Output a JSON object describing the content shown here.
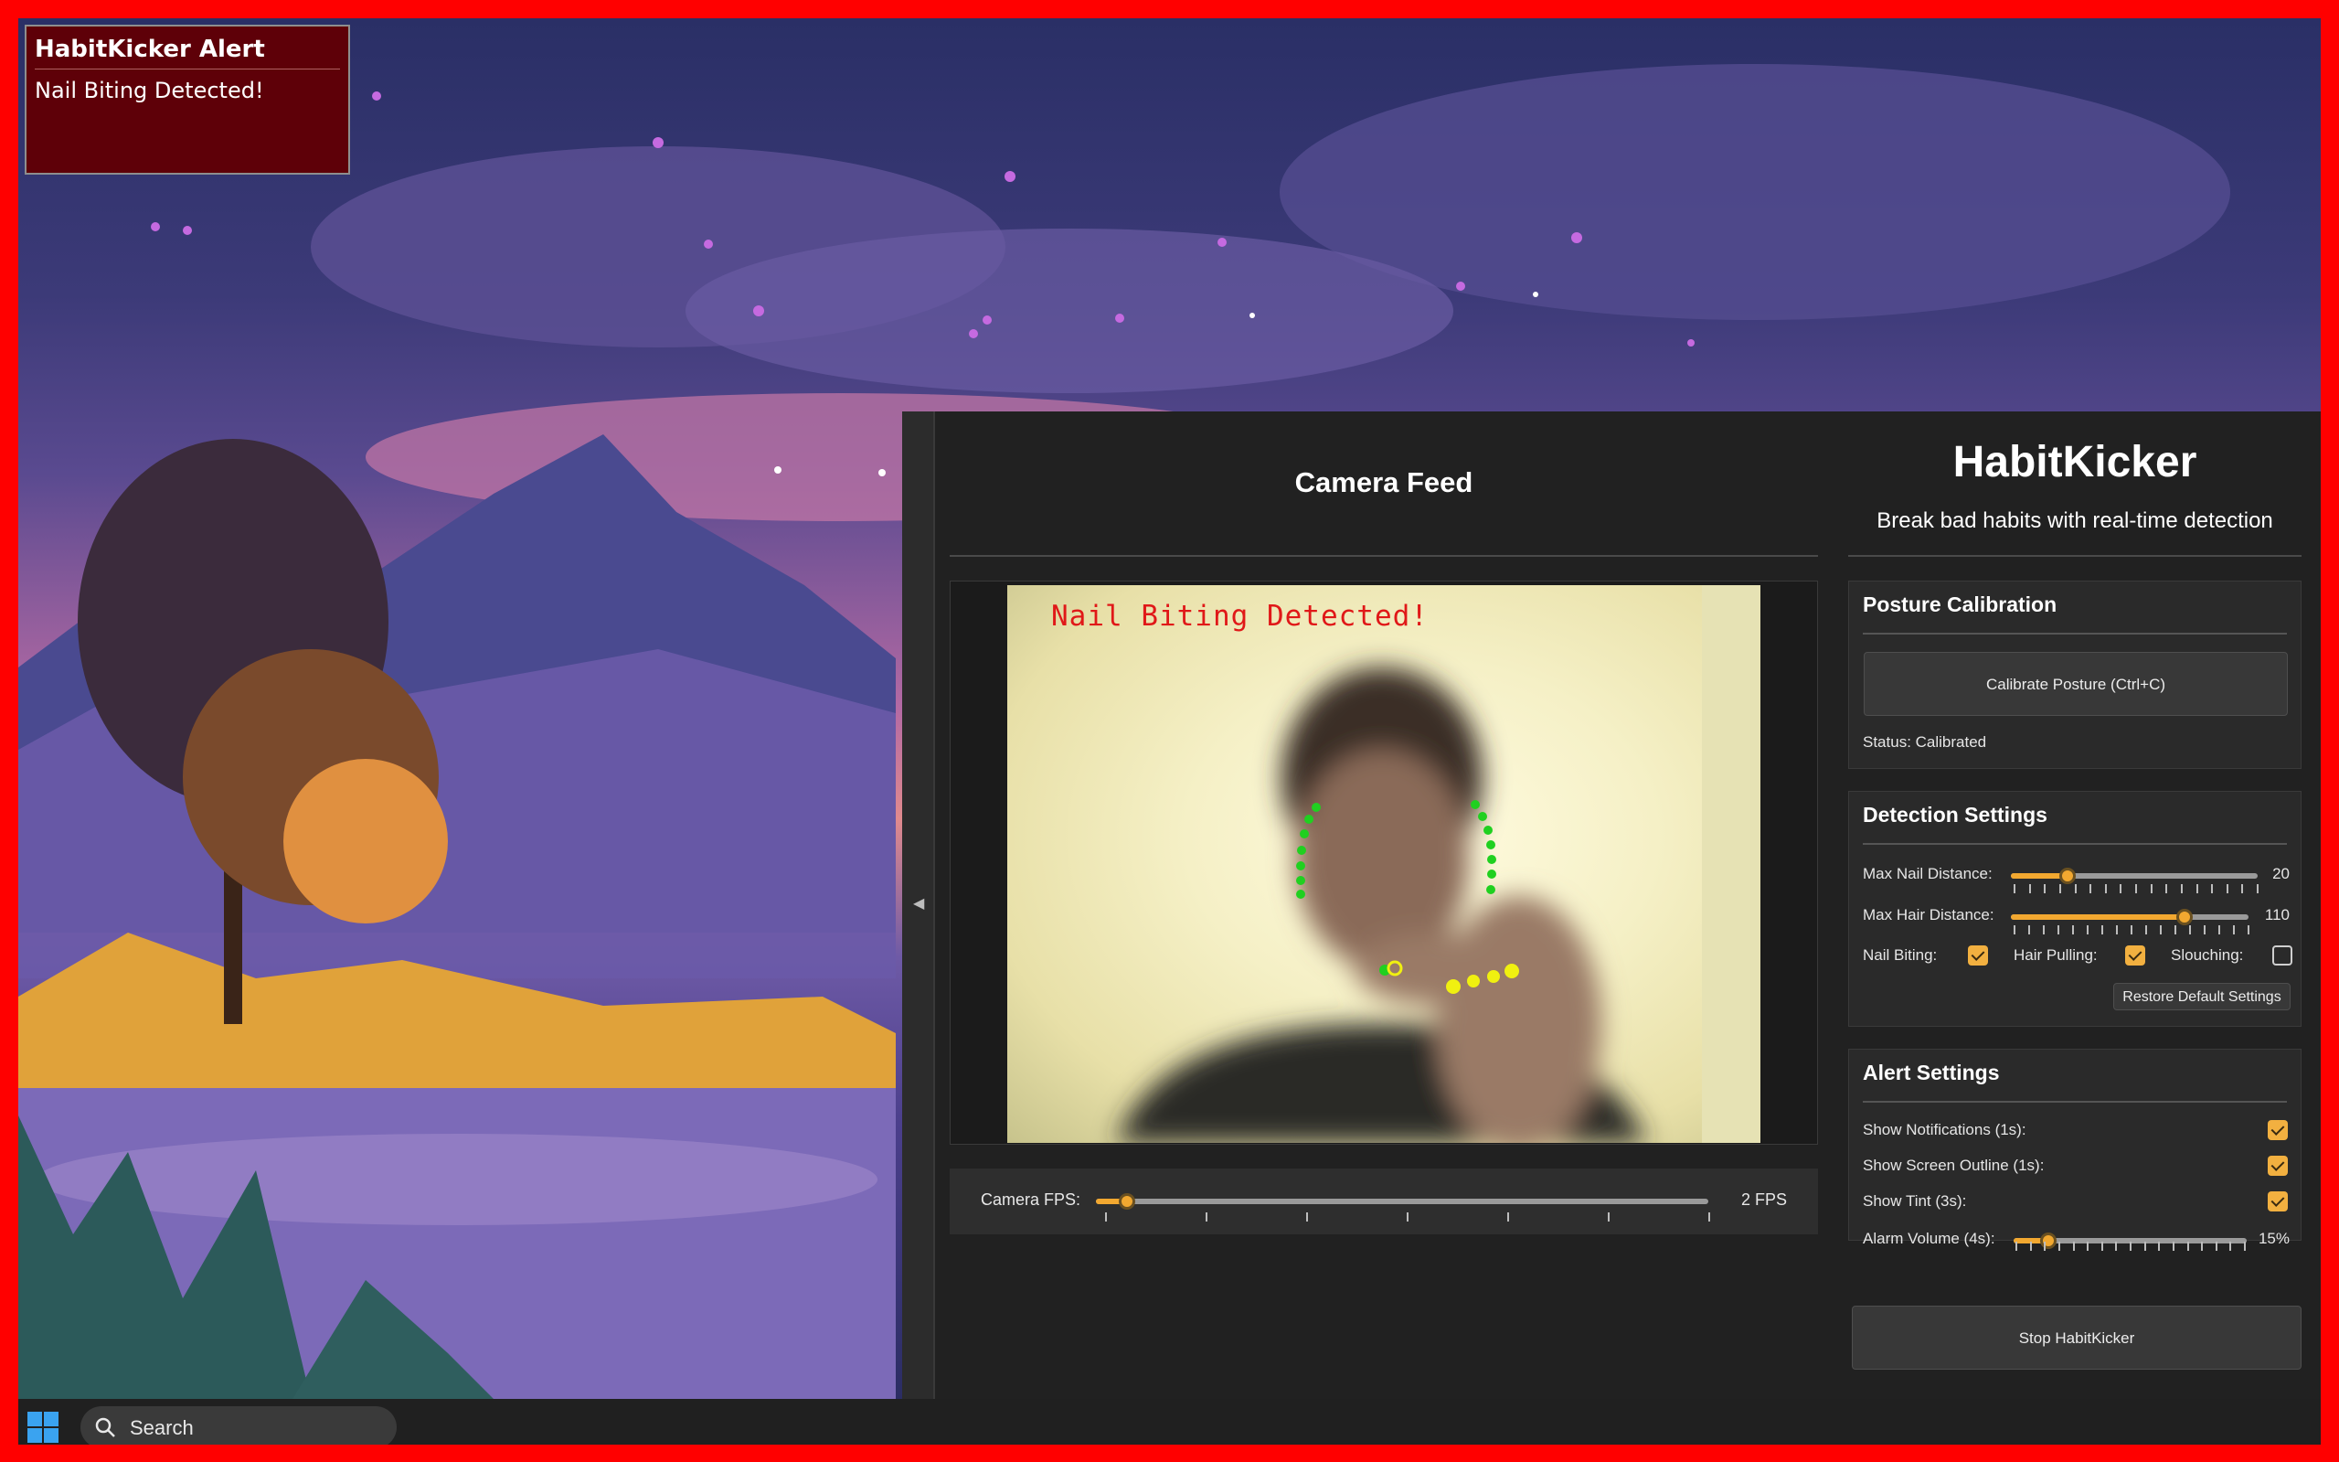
{
  "alert": {
    "title": "HabitKicker Alert",
    "message": "Nail Biting Detected!"
  },
  "taskbar": {
    "search_label": "Search"
  },
  "camera": {
    "title": "Camera Feed",
    "overlay_text": "Nail Biting Detected!",
    "fps_label": "Camera FPS:",
    "fps_value": "2 FPS",
    "fps_fraction": 0.05
  },
  "app": {
    "title": "HabitKicker",
    "subtitle": "Break bad habits with real-time detection"
  },
  "posture": {
    "title": "Posture Calibration",
    "calibrate_button": "Calibrate Posture (Ctrl+C)",
    "status": "Status: Calibrated"
  },
  "detection": {
    "title": "Detection Settings",
    "nail_label": "Max Nail Distance:",
    "nail_value": "20",
    "nail_fraction": 0.23,
    "hair_label": "Max Hair Distance:",
    "hair_value": "110",
    "hair_fraction": 0.73,
    "nail_biting_label": "Nail Biting:",
    "nail_biting_checked": true,
    "hair_pulling_label": "Hair Pulling:",
    "hair_pulling_checked": true,
    "slouching_label": "Slouching:",
    "slouching_checked": false,
    "restore_button": "Restore Default Settings"
  },
  "alerts": {
    "title": "Alert Settings",
    "notifications_label": "Show Notifications (1s):",
    "notifications_checked": true,
    "outline_label": "Show Screen Outline (1s):",
    "outline_checked": true,
    "tint_label": "Show Tint (3s):",
    "tint_checked": true,
    "volume_label": "Alarm Volume (4s):",
    "volume_value": "15%",
    "volume_fraction": 0.15
  },
  "stop_button": "Stop HabitKicker",
  "colors": {
    "accent": "#f2a830",
    "alert_red": "#e01818",
    "outline": "#ff0000",
    "app_bg": "#212121"
  }
}
